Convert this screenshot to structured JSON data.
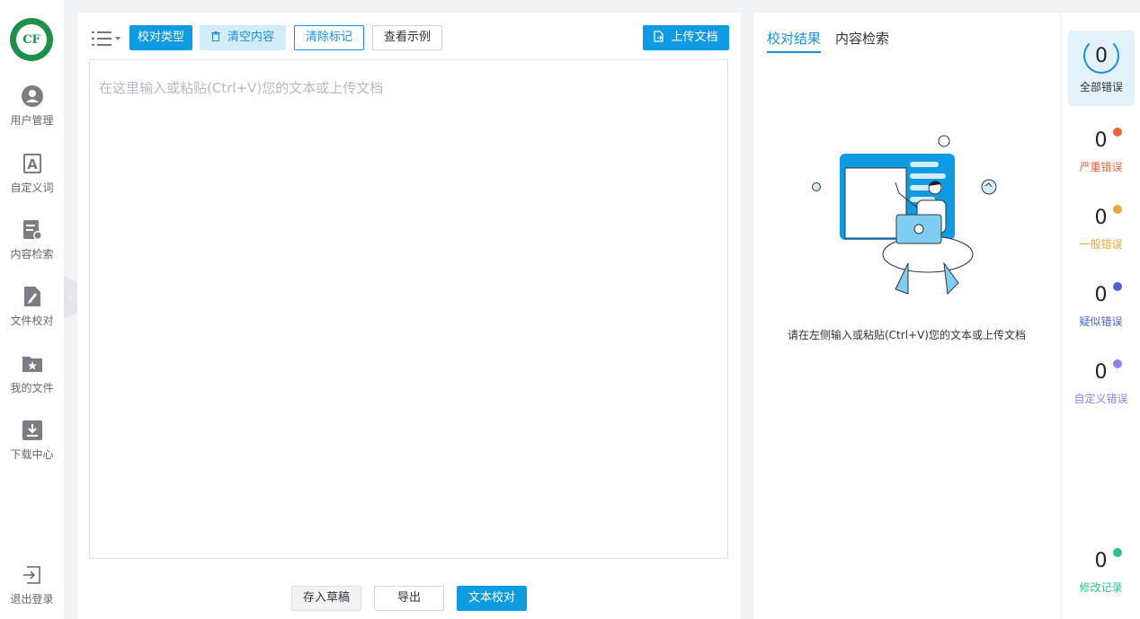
{
  "nav": {
    "logo_text": "CF",
    "items": [
      {
        "label": "用户管理",
        "icon": "user-icon"
      },
      {
        "label": "自定义词",
        "icon": "letter-a-icon"
      },
      {
        "label": "内容检索",
        "icon": "document-search-icon"
      },
      {
        "label": "文件校对",
        "icon": "edit-file-icon"
      },
      {
        "label": "我的文件",
        "icon": "star-folder-icon"
      },
      {
        "label": "下载中心",
        "icon": "download-icon"
      }
    ],
    "logout_label": "退出登录",
    "collapse_glyph": "‹"
  },
  "toolbar": {
    "proof_type": "校对类型",
    "clear_content": "清空内容",
    "clear_marks": "清除标记",
    "view_example": "查看示例",
    "upload_doc": "上传文档"
  },
  "editor": {
    "placeholder": "在这里输入或粘贴(Ctrl+V)您的文本或上传文档",
    "value": ""
  },
  "actions": {
    "save_draft": "存入草稿",
    "export": "导出",
    "proofread": "文本校对"
  },
  "results": {
    "tabs": [
      {
        "label": "校对结果",
        "active": true
      },
      {
        "label": "内容检索",
        "active": false
      }
    ],
    "empty_text": "请在左侧输入或粘贴(Ctrl+V)您的文本或上传文档"
  },
  "stats": {
    "total": {
      "count": "0",
      "label": "全部错误"
    },
    "items": [
      {
        "count": "0",
        "label": "严重错误",
        "color": "#e8663a"
      },
      {
        "count": "0",
        "label": "一般错误",
        "color": "#e8a93a"
      },
      {
        "count": "0",
        "label": "疑似错误",
        "color": "#4a64d8"
      },
      {
        "count": "0",
        "label": "自定义错误",
        "color": "#9b7be8"
      },
      {
        "count": "0",
        "label": "修改记录",
        "color": "#2ec08a"
      }
    ]
  },
  "colors": {
    "accent": "#0e9be2",
    "brand_green": "#1f8f4a"
  }
}
